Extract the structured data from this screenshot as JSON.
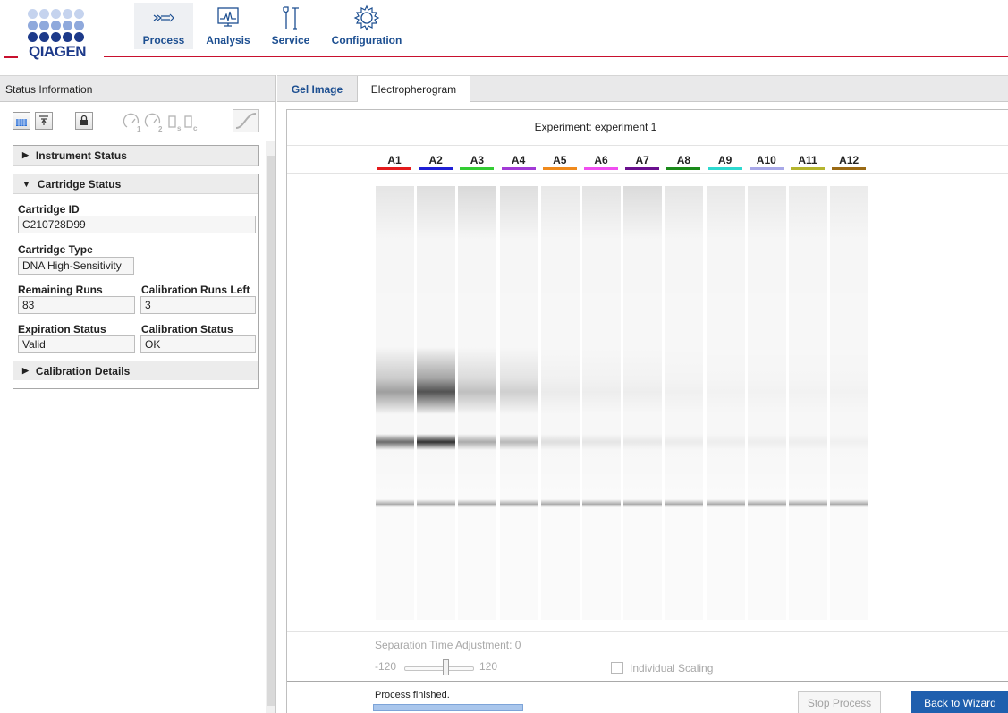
{
  "brand": {
    "logo_text": "QIAGEN",
    "accent": "#c8102e",
    "dot_colors": [
      "#b7c8e8",
      "#8aa7d8",
      "#1d3a8a"
    ]
  },
  "nav": {
    "process": "Process",
    "analysis": "Analysis",
    "service": "Service",
    "configuration": "Configuration"
  },
  "left_panel": {
    "title": "Status Information",
    "toolbar_icons": [
      "grid-icon",
      "align-top-icon",
      "lock-icon",
      "gauge1-icon",
      "gauge2-icon",
      "cartridge-s-icon",
      "cartridge-c-icon",
      "curve-icon"
    ],
    "instrument_status": "Instrument Status",
    "cartridge_status": "Cartridge Status",
    "cartridge_id_label": "Cartridge ID",
    "cartridge_id": "C210728D99",
    "cartridge_type_label": "Cartridge Type",
    "cartridge_type": "DNA High-Sensitivity",
    "remaining_runs_label": "Remaining Runs",
    "remaining_runs": "83",
    "calibration_runs_left_label": "Calibration Runs Left",
    "calibration_runs_left": "3",
    "expiration_status_label": "Expiration Status",
    "expiration_status": "Valid",
    "calibration_status_label": "Calibration Status",
    "calibration_status": "OK",
    "calibration_details": "Calibration Details"
  },
  "tabs": {
    "gel_image": "Gel Image",
    "electropherogram": "Electropherogram"
  },
  "gel": {
    "experiment_title": "Experiment: experiment 1",
    "lanes": [
      {
        "label": "A1",
        "color": "#e41a1c"
      },
      {
        "label": "A2",
        "color": "#1f1fd6"
      },
      {
        "label": "A3",
        "color": "#33cc33"
      },
      {
        "label": "A4",
        "color": "#a23ad6"
      },
      {
        "label": "A5",
        "color": "#f08a1c"
      },
      {
        "label": "A6",
        "color": "#f04ef0"
      },
      {
        "label": "A7",
        "color": "#6a0f8e"
      },
      {
        "label": "A8",
        "color": "#1a8a1a"
      },
      {
        "label": "A9",
        "color": "#2ed9d0"
      },
      {
        "label": "A10",
        "color": "#a8a8e8"
      },
      {
        "label": "A11",
        "color": "#b5b52e"
      },
      {
        "label": "A12",
        "color": "#9a6a14"
      }
    ]
  },
  "controls": {
    "separation_label": "Separation Time Adjustment: 0",
    "slider_min": "-120",
    "slider_max": "120",
    "individual_scaling": "Individual Scaling",
    "individual_scaling_checked": false
  },
  "status": {
    "text": "Process finished.",
    "stop_button": "Stop Process",
    "back_button": "Back to Wizard"
  }
}
